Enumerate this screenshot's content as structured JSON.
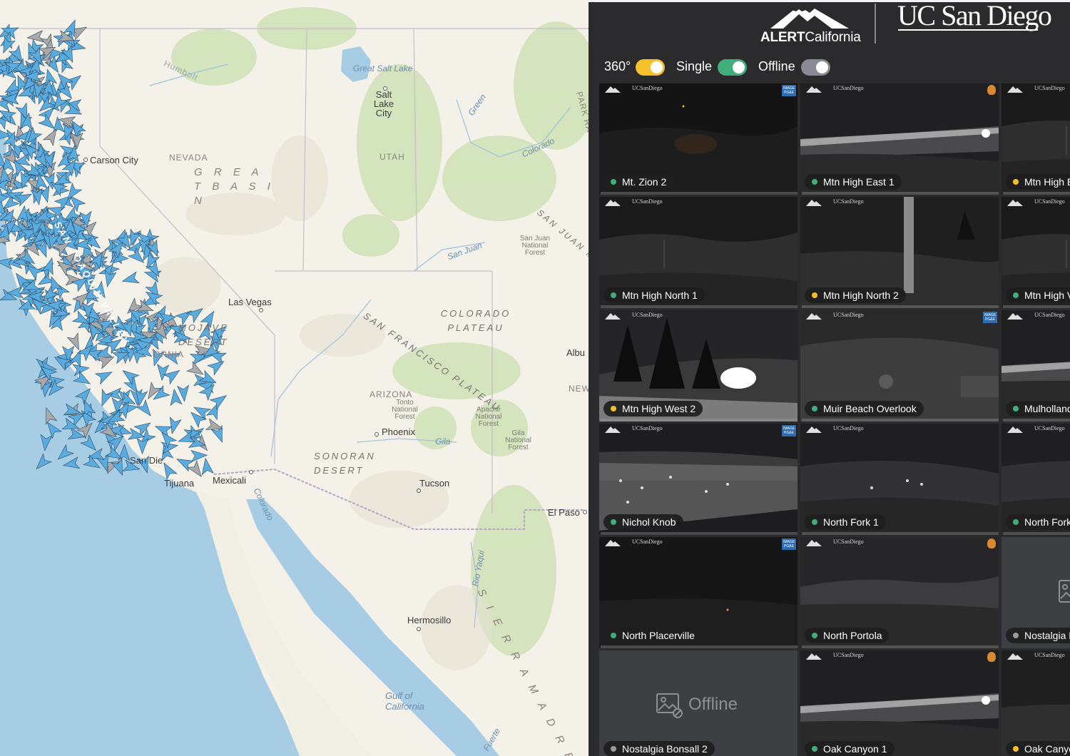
{
  "map": {
    "labels": {
      "humboldt": "Humbolt",
      "great_salt_lake": "Great Salt Lake",
      "salt_lake_city": "Salt Lake City",
      "green": "Green",
      "park_range": "PARK RA",
      "carson_city": "Carson City",
      "nevada": "NEVADA",
      "great_basin": "G R E A T  B A S I N",
      "utah": "UTAH",
      "colorado_river": "Colorado",
      "san_juan_mountains": "SAN JUAN MOU",
      "san_juan_forest": "San Juan National Forest",
      "san_juan_river": "San Juan",
      "san_joaquin_valley": "SAN JOAQUIN VALLEY",
      "las_vegas": "Las Vegas",
      "mojave_desert": "MOJAVE DESERT",
      "california": "ORNIA",
      "colorado_plateau": "COLORADO PLATEAU",
      "albuquerque": "Albu",
      "new_mexico": "NEW",
      "san_francisco_plateau": "SAN FRANCISCO PLATEAU",
      "arizona": "ARIZONA",
      "tonto_forest": "Tonto National Forest",
      "apache_forest": "Apache National Forest",
      "phoenix": "Phoenix",
      "gila_river": "Gila",
      "gila_forest": "Gila National Forest",
      "sonoran_desert": "SONORAN DESERT",
      "san_diego": "San Die",
      "tijuana": "Tijuana",
      "mexicali": "Mexicali",
      "tucson": "Tucson",
      "el_paso": "El Paso",
      "colorado_river_mx": "Colorado",
      "rio_yaqui": "Rio Yaqui",
      "hermosillo": "Hermosillo",
      "sierra_madre": "S I E R R A  M A D R E",
      "gulf_of_california": "Gulf of California",
      "fuerte": "Fuerte"
    },
    "marker_colors": {
      "online": "#5aacdf",
      "offline": "#a9a9a9",
      "stroke": "#2c4a66"
    }
  },
  "header": {
    "alert_logo_bold": "ALERT",
    "alert_logo_light": "California",
    "ucsd_logo": "UC San Diego"
  },
  "filters": [
    {
      "label": "360°",
      "color": "#f5c02a",
      "on": true
    },
    {
      "label": "Single",
      "color": "#3fae7a",
      "on": true
    },
    {
      "label": "Offline",
      "color": "#8a8b92",
      "on": true
    }
  ],
  "status_colors": {
    "online": "#3fae7a",
    "360": "#f5c02a",
    "offline": "#9a9a9a"
  },
  "cameras": [
    {
      "name": "Mt. Zion 2",
      "status": "online",
      "badge": true,
      "fire": false,
      "scene": "dark-fire"
    },
    {
      "name": "Mtn High East 1",
      "status": "online",
      "badge": false,
      "fire": true,
      "scene": "city-lights"
    },
    {
      "name": "Mtn High E",
      "status": "360",
      "badge": false,
      "fire": false,
      "scene": "dark-ridge"
    },
    {
      "name": "Mtn High North 1",
      "status": "online",
      "badge": false,
      "fire": false,
      "scene": "dark-ridge"
    },
    {
      "name": "Mtn High North 2",
      "status": "360",
      "badge": false,
      "fire": false,
      "scene": "pole"
    },
    {
      "name": "Mtn High V",
      "status": "online",
      "badge": false,
      "fire": false,
      "scene": "dark-ridge"
    },
    {
      "name": "Mtn High West 2",
      "status": "360",
      "badge": false,
      "fire": false,
      "scene": "trees-bright"
    },
    {
      "name": "Muir Beach Overlook",
      "status": "online",
      "badge": true,
      "fire": false,
      "scene": "hill"
    },
    {
      "name": "Mulholland",
      "status": "online",
      "badge": false,
      "fire": false,
      "scene": "city-lights"
    },
    {
      "name": "Nichol Knob",
      "status": "online",
      "badge": true,
      "fire": false,
      "scene": "city-dense"
    },
    {
      "name": "North Fork 1",
      "status": "online",
      "badge": false,
      "fire": false,
      "scene": "valley"
    },
    {
      "name": "North Fork",
      "status": "online",
      "badge": false,
      "fire": false,
      "scene": "valley"
    },
    {
      "name": "North Placerville",
      "status": "online",
      "badge": true,
      "fire": false,
      "scene": "dark"
    },
    {
      "name": "North Portola",
      "status": "online",
      "badge": false,
      "fire": true,
      "scene": "ridge-lit"
    },
    {
      "name": "Nostalgia E",
      "status": "offline",
      "badge": false,
      "fire": false,
      "scene": "broken"
    },
    {
      "name": "Nostalgia Bonsall 2",
      "status": "offline",
      "badge": false,
      "fire": false,
      "scene": "offline",
      "offline_text": "Offline"
    },
    {
      "name": "Oak Canyon 1",
      "status": "online",
      "badge": false,
      "fire": true,
      "scene": "city-lights"
    },
    {
      "name": "Oak Canyo",
      "status": "360",
      "badge": false,
      "fire": false,
      "scene": "pole"
    }
  ],
  "tile_header": {
    "uc_text": "UCSanDiego",
    "badge_text": "IMAGE PG&E"
  }
}
